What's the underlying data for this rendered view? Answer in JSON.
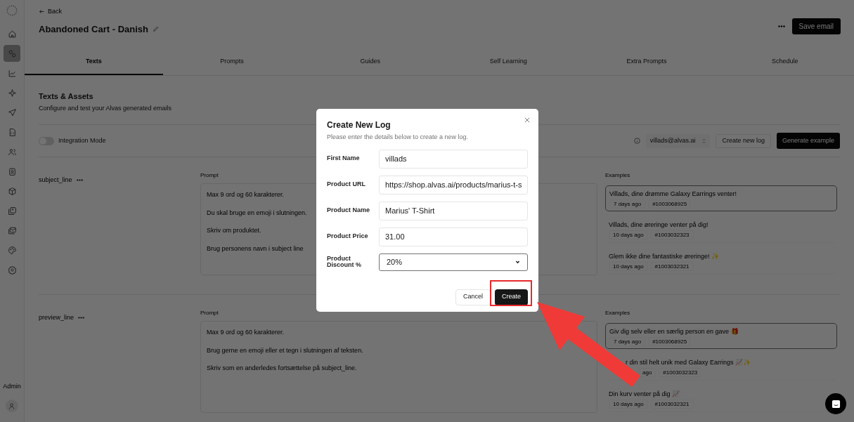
{
  "sidebar": {
    "items": [
      {
        "selected": false
      },
      {
        "selected": true
      },
      {
        "selected": false
      },
      {
        "selected": false
      },
      {
        "selected": false
      },
      {
        "selected": false
      },
      {
        "selected": false
      },
      {
        "selected": false
      },
      {
        "selected": false
      },
      {
        "selected": false
      },
      {
        "selected": false
      },
      {
        "selected": false
      },
      {
        "selected": false
      }
    ],
    "role_label": "Admin"
  },
  "header": {
    "back": "Back",
    "title": "Abandoned Cart - Danish",
    "save_button": "Save email"
  },
  "tabs": [
    {
      "label": "Texts",
      "selected": true
    },
    {
      "label": "Prompts",
      "selected": false
    },
    {
      "label": "Guides",
      "selected": false
    },
    {
      "label": "Self Learning",
      "selected": false
    },
    {
      "label": "Extra Prompts",
      "selected": false
    },
    {
      "label": "Schedule",
      "selected": false
    }
  ],
  "section": {
    "title": "Texts & Assets",
    "subtitle": "Configure and test your Alvas generated emails"
  },
  "toolbar": {
    "integration_mode": {
      "label": "Integration Mode",
      "on": false
    },
    "account": "villads@alvas.ai",
    "create_log": "Create new log",
    "generate": "Generate example"
  },
  "fields": [
    {
      "name": "subject_line",
      "prompt_label": "Prompt",
      "prompt": [
        "Max 9 ord og 60 karakterer.",
        "Du skal bruge en emoji i slutningen.",
        "Skriv om produktet.",
        "Brug personens navn i subject line"
      ],
      "examples_label": "Examples",
      "examples": [
        {
          "text": "Villads, dine drømme Galaxy Earrings venter!",
          "age": "7 days ago",
          "id": "#1003068925",
          "selected": true
        },
        {
          "text": "Villads, dine øreringe venter på dig!",
          "age": "10 days ago",
          "id": "#1003032323",
          "selected": false
        },
        {
          "text": "Glem ikke dine fantastiske øreringe! ✨",
          "age": "10 days ago",
          "id": "#1003032321",
          "selected": false
        }
      ]
    },
    {
      "name": "preview_line",
      "prompt_label": "Prompt",
      "prompt": [
        "Max 9 ord og 60 karakterer.",
        "Brug gerne en emoji eller et tegn i slutningen af teksten.",
        "Skriv som en anderledes fortsættelse på subject_line."
      ],
      "examples_label": "Examples",
      "examples": [
        {
          "text": "Giv dig selv eller en særlig person en gave 🎁",
          "age": "7 days ago",
          "id": "#1003068925",
          "selected": true
        },
        {
          "text": [
            "r din stil helt unik med Galaxy Earrings 📈✨"
          ],
          "age": "ago",
          "id": "#1003032323",
          "selected": false
        },
        {
          "text": [
            "Din kurv venter på dig 📈"
          ],
          "age": "10 days ago",
          "id": "#1003032321",
          "selected": false
        }
      ]
    }
  ],
  "dialog": {
    "title": "Create New Log",
    "description": "Please enter the details below to create a new log.",
    "fields": [
      {
        "kind": "text",
        "label": "First Name",
        "value": "villads"
      },
      {
        "kind": "text",
        "label": "Product URL",
        "value": "https://shop.alvas.ai/products/marius-t-s"
      },
      {
        "kind": "text",
        "label": "Product Name",
        "value": "Marius' T-Shirt"
      },
      {
        "kind": "text",
        "label": "Product Price",
        "value": "31.00"
      },
      {
        "kind": "select",
        "label": "Product Discount %",
        "value": "20%"
      }
    ],
    "cancel": "Cancel",
    "create": "Create",
    "create_highlighted": true
  }
}
